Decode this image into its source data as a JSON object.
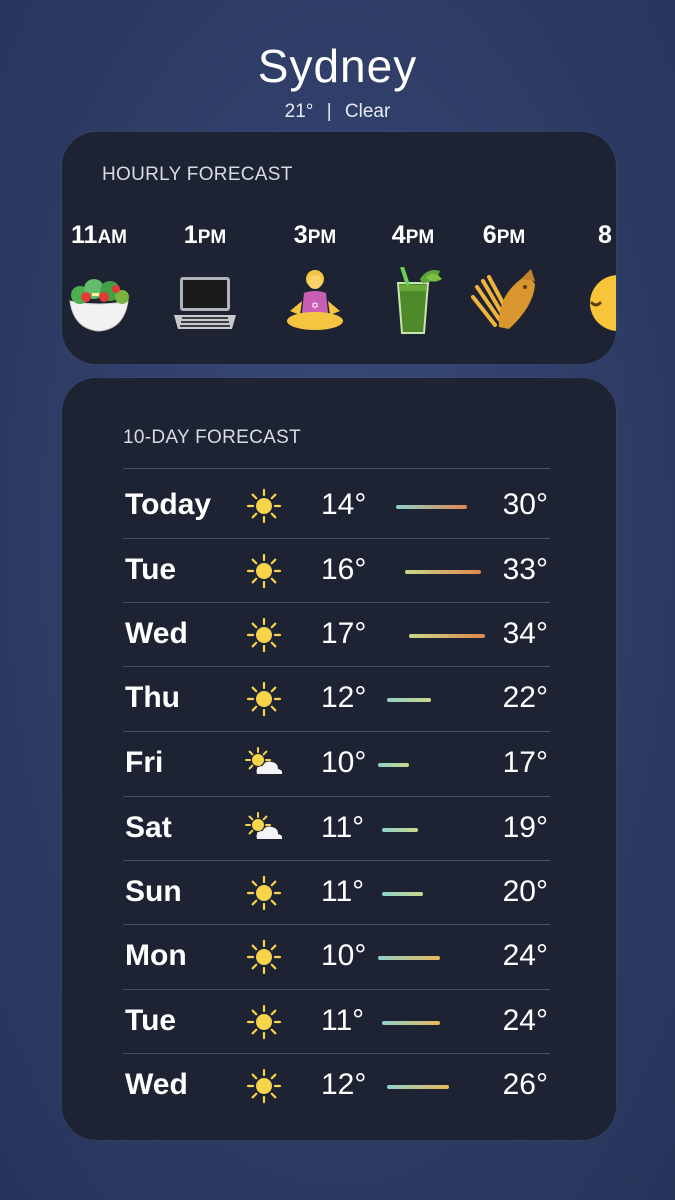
{
  "location": {
    "city": "Sydney",
    "temp": "21°",
    "separator": "|",
    "condition": "Clear"
  },
  "hourly": {
    "title": "HOURLY FORECAST",
    "items": [
      {
        "hour": "11",
        "suffix": "AM",
        "icon": "salad-icon"
      },
      {
        "hour": "1",
        "suffix": "PM",
        "icon": "laptop-icon"
      },
      {
        "hour": "3",
        "suffix": "PM",
        "icon": "meditation-icon"
      },
      {
        "hour": "4",
        "suffix": "PM",
        "icon": "green-juice-icon"
      },
      {
        "hour": "6",
        "suffix": "PM",
        "icon": "fish-and-chips-icon"
      },
      {
        "hour": "8",
        "suffix": "",
        "icon": "sleeping-face-icon"
      }
    ]
  },
  "daily": {
    "title": "10-DAY FORECAST",
    "range_min": 10,
    "range_max": 34,
    "days": [
      {
        "day": "Today",
        "icon": "sun-icon",
        "low": "14°",
        "high": "30°",
        "low_val": 14,
        "high_val": 30
      },
      {
        "day": "Tue",
        "icon": "sun-icon",
        "low": "16°",
        "high": "33°",
        "low_val": 16,
        "high_val": 33
      },
      {
        "day": "Wed",
        "icon": "sun-icon",
        "low": "17°",
        "high": "34°",
        "low_val": 17,
        "high_val": 34
      },
      {
        "day": "Thu",
        "icon": "sun-icon",
        "low": "12°",
        "high": "22°",
        "low_val": 12,
        "high_val": 22
      },
      {
        "day": "Fri",
        "icon": "partly-cloudy-icon",
        "low": "10°",
        "high": "17°",
        "low_val": 10,
        "high_val": 17
      },
      {
        "day": "Sat",
        "icon": "partly-cloudy-icon",
        "low": "11°",
        "high": "19°",
        "low_val": 11,
        "high_val": 19
      },
      {
        "day": "Sun",
        "icon": "sun-icon",
        "low": "11°",
        "high": "20°",
        "low_val": 11,
        "high_val": 20
      },
      {
        "day": "Mon",
        "icon": "sun-icon",
        "low": "10°",
        "high": "24°",
        "low_val": 10,
        "high_val": 24
      },
      {
        "day": "Tue",
        "icon": "sun-icon",
        "low": "11°",
        "high": "24°",
        "low_val": 11,
        "high_val": 24
      },
      {
        "day": "Wed",
        "icon": "sun-icon",
        "low": "12°",
        "high": "26°",
        "low_val": 12,
        "high_val": 26
      }
    ]
  },
  "colors": {
    "card_bg": "#1e2333",
    "sun": "#f7d54a",
    "cool": "#8fd1c9",
    "mild": "#c9d98a",
    "warm": "#e9b85a",
    "hot": "#e0864f"
  }
}
